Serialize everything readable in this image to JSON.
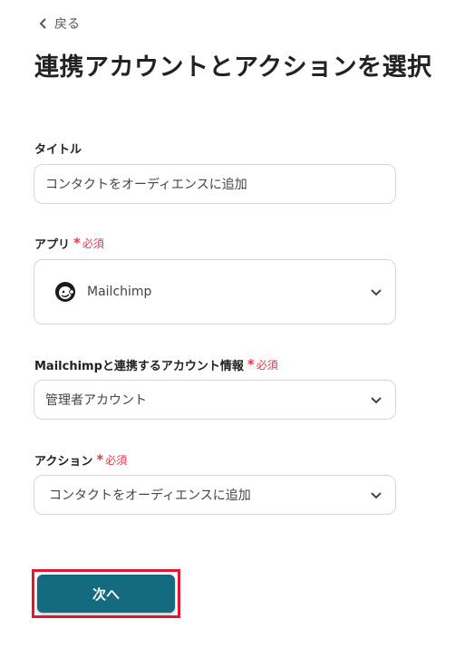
{
  "nav": {
    "back_label": "戻る"
  },
  "page": {
    "title": "連携アカウントとアクションを選択"
  },
  "form": {
    "title_field": {
      "label": "タイトル",
      "value": "コンタクトをオーディエンスに追加"
    },
    "app_field": {
      "label": "アプリ",
      "required": "必須",
      "value": "Mailchimp",
      "icon": "mailchimp-logo"
    },
    "account_field": {
      "label": "Mailchimpと連携するアカウント情報",
      "required": "必須",
      "value": "管理者アカウント"
    },
    "action_field": {
      "label": "アクション",
      "required": "必須",
      "value": "コンタクトをオーディエンスに追加"
    }
  },
  "actions": {
    "next_label": "次へ"
  },
  "colors": {
    "accent": "#146b80",
    "required": "#e0394b",
    "highlight": "#e0192e"
  }
}
